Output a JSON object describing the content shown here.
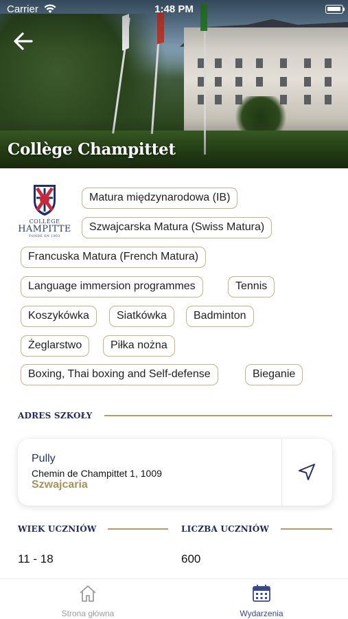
{
  "status_bar": {
    "carrier": "Carrier",
    "time": "1:48 PM"
  },
  "header": {
    "title": "Collège Champittet"
  },
  "logo": {
    "line1": "COLLÈGE",
    "line2": "HAMPITTE",
    "line3": "FONDÉ EN 1903"
  },
  "tags": [
    "Matura międzynarodowa (IB)",
    "Szwajcarska Matura (Swiss Matura)",
    "Francuska Matura (French Matura)",
    "Language immersion programmes",
    "Tennis",
    "Koszykówka",
    "Siatkówka",
    "Badminton",
    "Żeglarstwo",
    "Piłka nożna",
    "Boxing, Thai boxing and Self-defense",
    "Bieganie"
  ],
  "address_section": {
    "heading": "ADRES SZKOŁY",
    "city": "Pully",
    "street": "Chemin de Champittet 1, 1009",
    "country": "Szwajcaria"
  },
  "age_section": {
    "heading": "WIEK UCZNIÓW",
    "value": "11 - 18"
  },
  "count_section": {
    "heading": "LICZBA UCZNIÓW",
    "value": "600"
  },
  "tabbar": {
    "home_label": "Strona główna",
    "events_label": "Wydarzenia"
  },
  "colors": {
    "accent_gold": "#b49b66",
    "navy": "#24306b",
    "tab_active": "#3a4690",
    "tab_inactive": "#9b9b9b"
  },
  "icons": [
    "back-arrow-icon",
    "wifi-icon",
    "battery-icon",
    "navigation-arrow-icon",
    "home-icon",
    "calendar-icon"
  ]
}
